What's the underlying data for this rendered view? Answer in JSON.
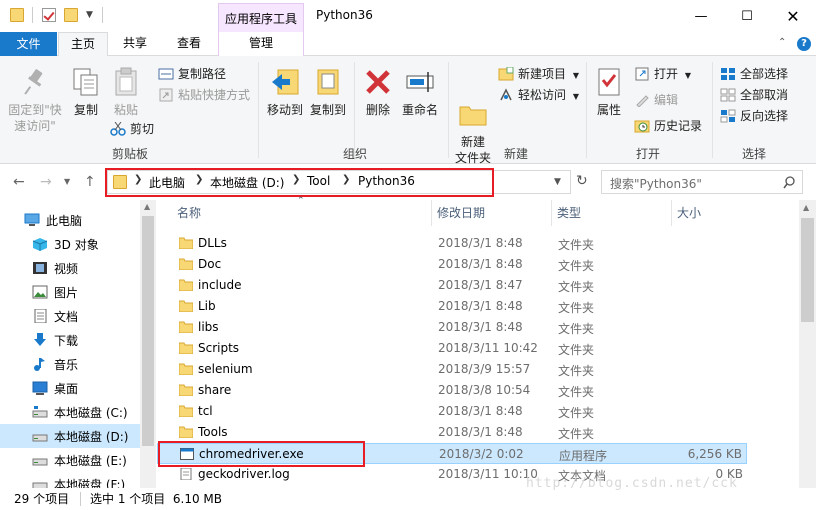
{
  "window": {
    "title": "Python36",
    "context_tab_group": "应用程序工具"
  },
  "ribbon_tabs": {
    "file": "文件",
    "home": "主页",
    "share": "共享",
    "view": "查看",
    "manage": "管理"
  },
  "ribbon": {
    "pin_quick_access": "固定到\"快速访问\"",
    "copy": "复制",
    "paste": "粘贴",
    "copy_path": "复制路径",
    "paste_shortcut": "粘贴快捷方式",
    "cut": "剪切",
    "clipboard_group": "剪贴板",
    "move_to": "移动到",
    "copy_to": "复制到",
    "delete": "删除",
    "rename": "重命名",
    "organize_group": "组织",
    "new_folder": "新建\n文件夹",
    "new_item": "新建项目",
    "easy_access": "轻松访问",
    "new_group": "新建",
    "properties": "属性",
    "open": "打开",
    "edit": "编辑",
    "history": "历史记录",
    "open_group": "打开",
    "select_all": "全部选择",
    "select_none": "全部取消",
    "invert_selection": "反向选择",
    "select_group": "选择"
  },
  "address": {
    "crumbs": [
      "此电脑",
      "本地磁盘 (D:)",
      "Tool",
      "Python36"
    ]
  },
  "search": {
    "placeholder": "搜索\"Python36\""
  },
  "nav_pane": {
    "items": [
      {
        "label": "此电脑",
        "icon": "computer-icon"
      },
      {
        "label": "3D 对象",
        "icon": "3d-objects-icon"
      },
      {
        "label": "视频",
        "icon": "video-icon"
      },
      {
        "label": "图片",
        "icon": "pictures-icon"
      },
      {
        "label": "文档",
        "icon": "documents-icon"
      },
      {
        "label": "下载",
        "icon": "downloads-icon"
      },
      {
        "label": "音乐",
        "icon": "music-icon"
      },
      {
        "label": "桌面",
        "icon": "desktop-icon"
      },
      {
        "label": "本地磁盘 (C:)",
        "icon": "drive-icon"
      },
      {
        "label": "本地磁盘 (D:)",
        "icon": "drive-icon"
      },
      {
        "label": "本地磁盘 (E:)",
        "icon": "drive-icon"
      },
      {
        "label": "本地磁盘 (F:)",
        "icon": "drive-icon"
      }
    ]
  },
  "file_list": {
    "columns": [
      "名称",
      "修改日期",
      "类型",
      "大小"
    ],
    "rows": [
      {
        "name": "DLLs",
        "date": "2018/3/1 8:48",
        "type": "文件夹",
        "size": "",
        "icon": "folder-icon"
      },
      {
        "name": "Doc",
        "date": "2018/3/1 8:48",
        "type": "文件夹",
        "size": "",
        "icon": "folder-icon"
      },
      {
        "name": "include",
        "date": "2018/3/1 8:47",
        "type": "文件夹",
        "size": "",
        "icon": "folder-icon"
      },
      {
        "name": "Lib",
        "date": "2018/3/1 8:48",
        "type": "文件夹",
        "size": "",
        "icon": "folder-icon"
      },
      {
        "name": "libs",
        "date": "2018/3/1 8:48",
        "type": "文件夹",
        "size": "",
        "icon": "folder-icon"
      },
      {
        "name": "Scripts",
        "date": "2018/3/11 10:42",
        "type": "文件夹",
        "size": "",
        "icon": "folder-icon"
      },
      {
        "name": "selenium",
        "date": "2018/3/9 15:57",
        "type": "文件夹",
        "size": "",
        "icon": "folder-icon"
      },
      {
        "name": "share",
        "date": "2018/3/8 10:54",
        "type": "文件夹",
        "size": "",
        "icon": "folder-icon"
      },
      {
        "name": "tcl",
        "date": "2018/3/1 8:48",
        "type": "文件夹",
        "size": "",
        "icon": "folder-icon"
      },
      {
        "name": "Tools",
        "date": "2018/3/1 8:48",
        "type": "文件夹",
        "size": "",
        "icon": "folder-icon"
      },
      {
        "name": "chromedriver.exe",
        "date": "2018/3/2 0:02",
        "type": "应用程序",
        "size": "6,256 KB",
        "icon": "exe-icon"
      },
      {
        "name": "geckodriver.log",
        "date": "2018/3/11 10:10",
        "type": "文本文档",
        "size": "0 KB",
        "icon": "text-file-icon"
      }
    ]
  },
  "status": {
    "item_count": "29 个项目",
    "selection": "选中 1 个项目  6.10 MB"
  },
  "watermark": "http://blog.csdn.net/cck",
  "colors": {
    "accent": "#1979ca",
    "selection": "#cce8ff",
    "highlight_box": "#e81c24",
    "folder": "#f8d775"
  }
}
